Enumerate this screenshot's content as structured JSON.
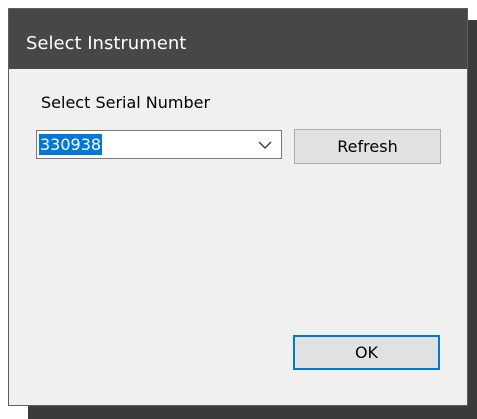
{
  "window": {
    "title": "Select Instrument"
  },
  "form": {
    "serial_label": "Select Serial Number",
    "serial_value": "330938",
    "refresh_label": "Refresh",
    "ok_label": "OK"
  },
  "colors": {
    "titlebar": "#474747",
    "selection": "#0078d7",
    "dialog_bg": "#f0f0f0"
  },
  "icons": {
    "dropdown": "chevron-down-icon"
  }
}
